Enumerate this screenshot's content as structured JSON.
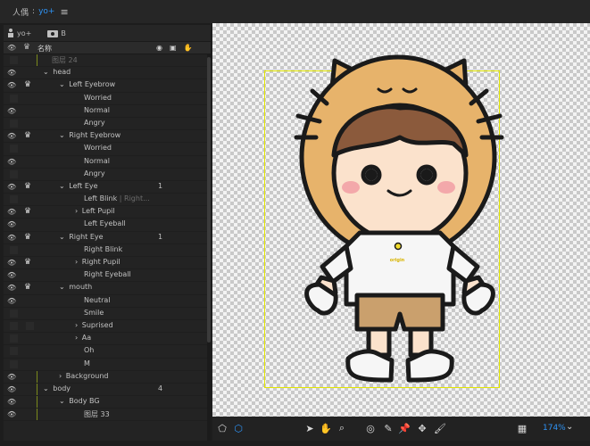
{
  "topbar": {
    "tab_label": "人偶",
    "active_tab": "yo+",
    "menu_icon": "hamburger-icon"
  },
  "panel_header": {
    "puppet_name": "yo+",
    "camera_label": "B"
  },
  "columns": {
    "name": "名称"
  },
  "layers": [
    {
      "label": "图层 24",
      "indent": 54,
      "eye": false,
      "crown": false,
      "dim": true,
      "guide": true
    },
    {
      "label": "head",
      "indent": 44,
      "eye": true,
      "crown": false,
      "arrow": "down"
    },
    {
      "label": "Left Eyebrow",
      "indent": 62,
      "eye": true,
      "crown": true,
      "arrow": "down"
    },
    {
      "label": "Worried",
      "indent": 90,
      "eye": false,
      "crown": false
    },
    {
      "label": "Normal",
      "indent": 90,
      "eye": true,
      "crown": false
    },
    {
      "label": "Angry",
      "indent": 90,
      "eye": false,
      "crown": false
    },
    {
      "label": "Right Eyebrow",
      "indent": 62,
      "eye": true,
      "crown": true,
      "arrow": "down"
    },
    {
      "label": "Worried",
      "indent": 90,
      "eye": false,
      "crown": false
    },
    {
      "label": "Normal",
      "indent": 90,
      "eye": true,
      "crown": false
    },
    {
      "label": "Angry",
      "indent": 90,
      "eye": false,
      "crown": false
    },
    {
      "label": "Left Eye",
      "indent": 62,
      "eye": true,
      "crown": true,
      "arrow": "down",
      "num": "1"
    },
    {
      "label": "Left Blink",
      "suffix": " | Right...",
      "indent": 90,
      "eye": false,
      "crown": false
    },
    {
      "label": "Left Pupil",
      "indent": 80,
      "eye": true,
      "crown": true,
      "arrow": "right"
    },
    {
      "label": "Left Eyeball",
      "indent": 90,
      "eye": true,
      "crown": false
    },
    {
      "label": "Right Eye",
      "indent": 62,
      "eye": true,
      "crown": true,
      "arrow": "down",
      "num": "1"
    },
    {
      "label": "Right Blink",
      "indent": 90,
      "eye": false,
      "crown": false
    },
    {
      "label": "Right Pupil",
      "indent": 80,
      "eye": true,
      "crown": true,
      "arrow": "right"
    },
    {
      "label": "Right Eyeball",
      "indent": 90,
      "eye": true,
      "crown": false
    },
    {
      "label": "mouth",
      "indent": 62,
      "eye": true,
      "crown": true,
      "arrow": "down"
    },
    {
      "label": "Neutral",
      "indent": 90,
      "eye": true,
      "crown": false
    },
    {
      "label": "Smile",
      "indent": 90,
      "eye": false,
      "crown": false
    },
    {
      "label": "Suprised",
      "indent": 80,
      "eye": false,
      "crown": false,
      "box": true,
      "arrow": "right"
    },
    {
      "label": "Aa",
      "indent": 80,
      "eye": false,
      "crown": false,
      "arrow": "right"
    },
    {
      "label": "Oh",
      "indent": 90,
      "eye": false,
      "crown": false
    },
    {
      "label": "M",
      "indent": 90,
      "eye": false,
      "crown": false
    },
    {
      "label": "Background",
      "indent": 62,
      "eye": true,
      "crown": false,
      "arrow": "right",
      "guide": true
    },
    {
      "label": "body",
      "indent": 44,
      "eye": true,
      "crown": false,
      "arrow": "down",
      "num": "4",
      "guide": true
    },
    {
      "label": "Body BG",
      "indent": 62,
      "eye": true,
      "crown": false,
      "arrow": "down",
      "guide": true
    },
    {
      "label": "图层 33",
      "indent": 90,
      "eye": true,
      "crown": false,
      "guide": true
    }
  ],
  "artwork": {
    "badge_text": "origin"
  },
  "toolbar": {
    "zoom": "174%"
  },
  "colors": {
    "accent": "#2e93f5",
    "guide": "#e2e600"
  }
}
